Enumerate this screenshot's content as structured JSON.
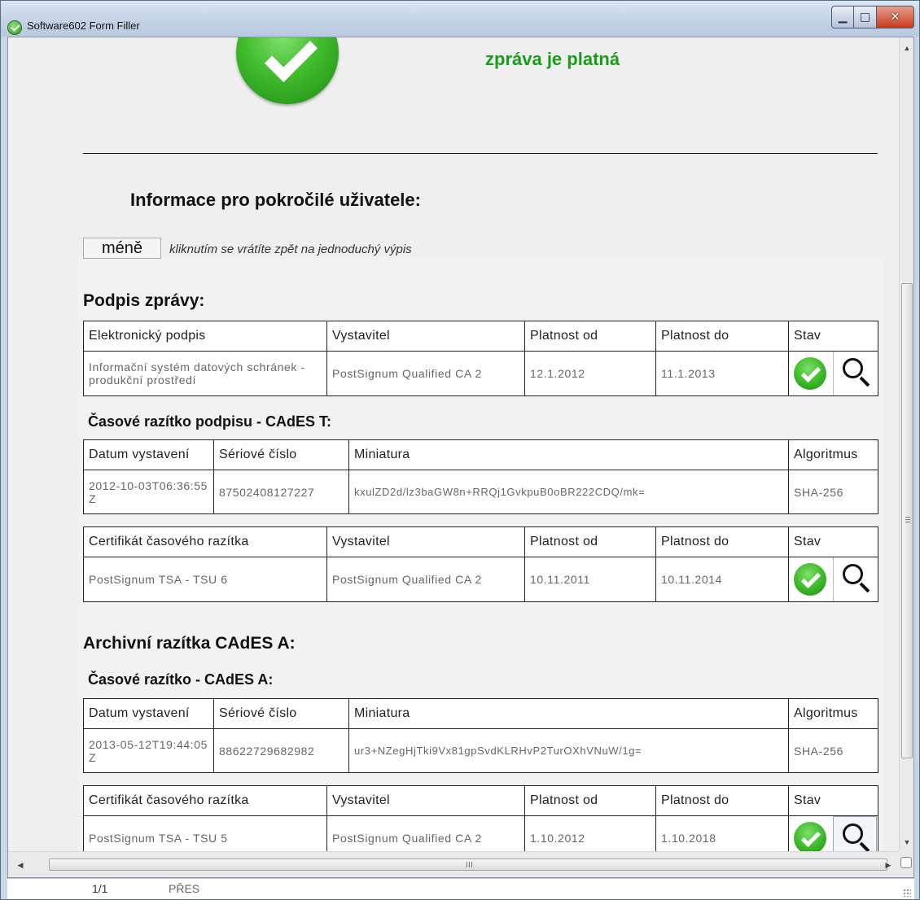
{
  "window": {
    "title": "Software602 Form Filler",
    "minimize_glyph": "▁",
    "maximize_glyph": "□",
    "close_glyph": "✕"
  },
  "validation": {
    "message": "zpráva je platná",
    "status": "valid",
    "status_color": "#1a9c1a"
  },
  "advanced": {
    "title": "Informace pro pokročilé uživatele:",
    "less_button": "méně",
    "less_hint": "kliknutím se vrátíte zpět na jednoduchý výpis"
  },
  "signature": {
    "heading": "Podpis zprávy:",
    "columns": [
      "Elektronický podpis",
      "Vystavitel",
      "Platnost od",
      "Platnost do",
      "Stav"
    ],
    "row": {
      "subject": "Informační systém datových schránek - produkční prostředí",
      "issuer": "PostSignum Qualified CA 2",
      "valid_from": "12.1.2012",
      "valid_to": "11.1.2013",
      "status_icon": "check-icon",
      "detail_icon": "magnifier-icon"
    }
  },
  "sig_timestamp": {
    "heading": "Časové razítko podpisu - CAdES T:",
    "columns": [
      "Datum vystavení",
      "Sériové číslo",
      "Miniatura",
      "Algoritmus"
    ],
    "row": {
      "date": "2012-10-03T06:36:55Z",
      "serial": "87502408127227",
      "thumbprint": "kxulZD2d/lz3baGW8n+RRQj1GvkpuB0oBR222CDQ/mk=",
      "algorithm": "SHA-256"
    },
    "cert_columns": [
      "Certifikát časového razítka",
      "Vystavitel",
      "Platnost od",
      "Platnost do",
      "Stav"
    ],
    "cert_row": {
      "subject": "PostSignum TSA - TSU 6",
      "issuer": "PostSignum Qualified CA 2",
      "valid_from": "10.11.2011",
      "valid_to": "10.11.2014",
      "status_icon": "check-icon",
      "detail_icon": "magnifier-icon"
    }
  },
  "archive": {
    "heading": "Archivní razítka CAdES A:",
    "ts_heading": "Časové razítko - CAdES A:",
    "columns": [
      "Datum vystavení",
      "Sériové číslo",
      "Miniatura",
      "Algoritmus"
    ],
    "row": {
      "date": "2013-05-12T19:44:05Z",
      "serial": "88622729682982",
      "thumbprint": "ur3+NZegHjTki9Vx81gpSvdKLRHvP2TurOXhVNuW/1g=",
      "algorithm": "SHA-256"
    },
    "cert_columns": [
      "Certifikát časového razítka",
      "Vystavitel",
      "Platnost od",
      "Platnost do",
      "Stav"
    ],
    "cert_row": {
      "subject": "PostSignum TSA - TSU 5",
      "issuer": "PostSignum Qualified CA 2",
      "valid_from": "1.10.2012",
      "valid_to": "1.10.2018",
      "status_icon": "check-icon",
      "detail_icon": "magnifier-icon"
    }
  },
  "statusbar": {
    "page": "1/1",
    "mode": "PŘES"
  },
  "scrollbar": {
    "up_arrow": "▲",
    "down_arrow": "▼",
    "left_arrow": "◀",
    "right_arrow": "▶"
  }
}
